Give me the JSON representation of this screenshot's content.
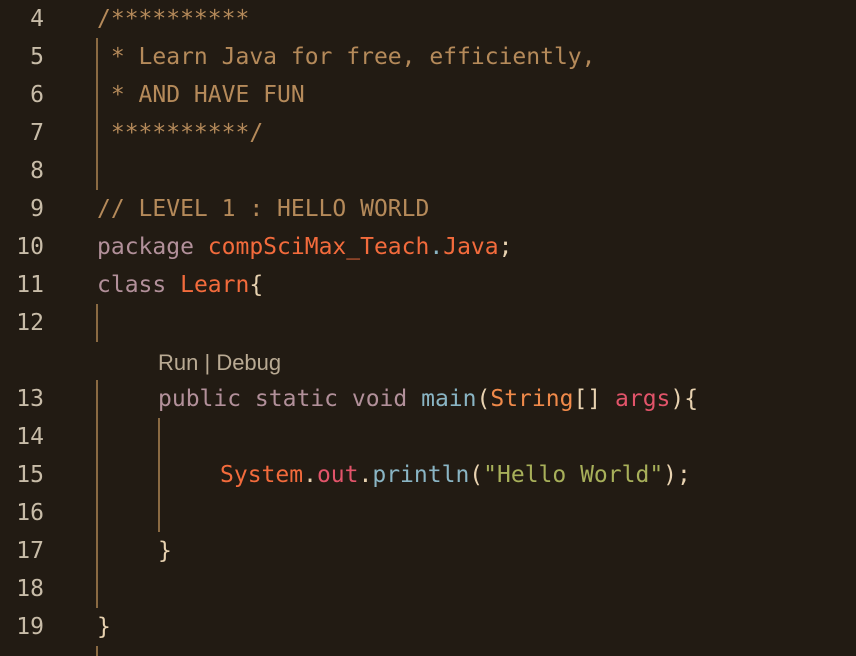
{
  "editor": {
    "line_numbers": [
      "4",
      "5",
      "6",
      "7",
      "8",
      "9",
      "10",
      "11",
      "12",
      "13",
      "14",
      "15",
      "16",
      "17",
      "18",
      "19"
    ],
    "codelens": {
      "run": "Run",
      "separator": " | ",
      "debug": "Debug"
    },
    "code": {
      "l4": "/**********",
      "l5": " * Learn Java for free, efficiently,",
      "l6": " * AND HAVE FUN",
      "l7": " **********/",
      "l9": "// LEVEL 1 : HELLO WORLD",
      "l10_kw": "package",
      "l10_pkg": "compSciMax_Teach",
      "l10_dot": ".",
      "l10_pkg2": "Java",
      "l10_semi": ";",
      "l11_kw": "class",
      "l11_cls": "Learn",
      "l11_brace": "{",
      "l13_mods": "public static void",
      "l13_fn": "main",
      "l13_paren": "(",
      "l13_type": "String",
      "l13_arr": "[]",
      "l13_param": "args",
      "l13_close": "){",
      "l15_sys": "System",
      "l15_dot1": ".",
      "l15_out": "out",
      "l15_dot2": ".",
      "l15_fn": "println",
      "l15_open": "(",
      "l15_str": "\"Hello World\"",
      "l15_close": ");",
      "l17": "}",
      "l19": "}"
    }
  },
  "colors": {
    "background": "#221b13",
    "comment": "#b58a5a",
    "keyword": "#b2909a",
    "identifier": "#f36b3c",
    "function": "#8ab5c4",
    "string": "#a8b05a"
  }
}
